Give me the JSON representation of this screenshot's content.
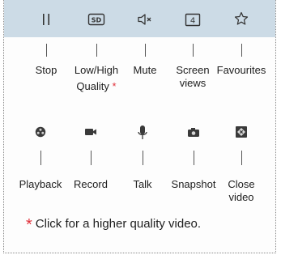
{
  "toolbar": {
    "items": [
      {
        "icon": "pause-icon",
        "label": "Stop"
      },
      {
        "icon": "sd-icon",
        "icon_text": "SD",
        "label_line1": "Low/High",
        "label_line2": "Quality",
        "asterisk": "*"
      },
      {
        "icon": "mute-icon",
        "label": "Mute"
      },
      {
        "icon": "screen-views-icon",
        "icon_text": "4",
        "label_line1": "Screen",
        "label_line2": "views"
      },
      {
        "icon": "star-icon",
        "label": "Favourites"
      }
    ]
  },
  "controls": {
    "items": [
      {
        "icon": "playback-icon",
        "label": "Playback"
      },
      {
        "icon": "record-icon",
        "label": "Record"
      },
      {
        "icon": "microphone-icon",
        "label": "Talk"
      },
      {
        "icon": "snapshot-icon",
        "label": "Snapshot"
      },
      {
        "icon": "close-video-icon",
        "label_line1": "Close",
        "label_line2": "video"
      }
    ]
  },
  "note": {
    "asterisk": "*",
    "text": "Click for a higher quality video."
  },
  "colors": {
    "toolbar_bg": "#ccdbe6",
    "icon_dark": "#2c2c2c",
    "accent_red": "#e0303a"
  }
}
